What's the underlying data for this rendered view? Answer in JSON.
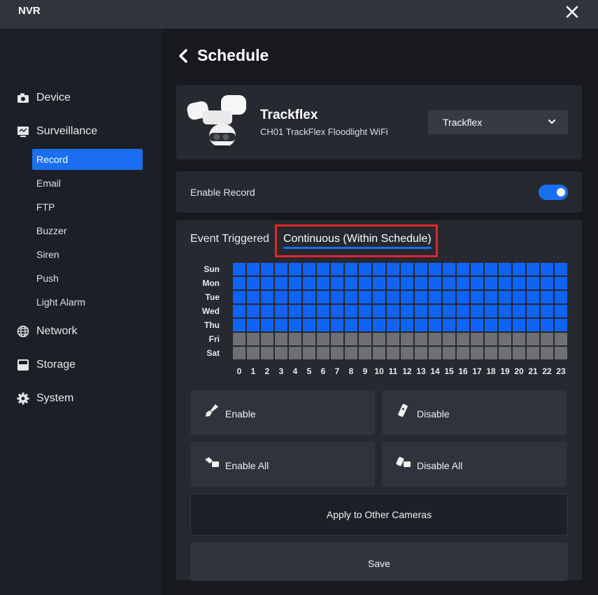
{
  "app": {
    "title": "NVR"
  },
  "sidebar": {
    "main_items": [
      {
        "label": "Device",
        "icon": "camera-icon"
      },
      {
        "label": "Surveillance",
        "icon": "monitor-icon"
      },
      {
        "label": "Network",
        "icon": "globe-icon"
      },
      {
        "label": "Storage",
        "icon": "hard-drive-icon"
      },
      {
        "label": "System",
        "icon": "gear-icon"
      }
    ],
    "sub_items": [
      "Record",
      "Email",
      "FTP",
      "Buzzer",
      "Siren",
      "Push",
      "Light Alarm"
    ],
    "active_sub": "Record"
  },
  "page": {
    "title": "Schedule"
  },
  "camera": {
    "name": "Trackflex",
    "description": "CH01 TrackFlex Floodlight WiFi",
    "selected": "Trackflex"
  },
  "record": {
    "enable_label": "Enable Record",
    "enabled": true
  },
  "tabs": {
    "event": "Event Triggered",
    "continuous": "Continuous (Within Schedule)",
    "active": "continuous"
  },
  "schedule": {
    "days": [
      "Sun",
      "Mon",
      "Tue",
      "Wed",
      "Thu",
      "Fri",
      "Sat"
    ],
    "hours": [
      "0",
      "1",
      "2",
      "3",
      "4",
      "5",
      "6",
      "7",
      "8",
      "9",
      "10",
      "11",
      "12",
      "13",
      "14",
      "15",
      "16",
      "17",
      "18",
      "19",
      "20",
      "21",
      "22",
      "23"
    ],
    "enabled_days": [
      true,
      true,
      true,
      true,
      true,
      false,
      false
    ],
    "on_color": "#0f63f5",
    "off_color": "#6f7074"
  },
  "buttons": {
    "enable": "Enable",
    "disable": "Disable",
    "enable_all": "Enable All",
    "disable_all": "Disable All",
    "apply": "Apply to Other Cameras",
    "save": "Save"
  },
  "colors": {
    "accent": "#1a6ff0",
    "highlight": "#e0252a"
  }
}
